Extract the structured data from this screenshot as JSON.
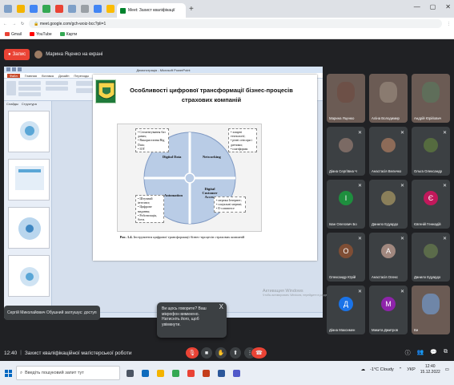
{
  "browser": {
    "active_tab_title": "Meet: Захист кваліфікації",
    "address": "meet.google.com/gch-woiz-bcc?pli=1",
    "bookmarks": [
      "Gmail",
      "YouTube",
      "Карти"
    ]
  },
  "meet_top": {
    "record_label": "Запис",
    "presenter_label": "Марина Яценко на екрані"
  },
  "powerpoint": {
    "window_title": "Демонстрація - Microsoft PowerPoint",
    "menu": [
      "Файл",
      "Главная",
      "Вставка",
      "Дизайн",
      "Переходы",
      "Анимация",
      "Показ слайдов",
      "Рецензирование",
      "Вид"
    ],
    "thumb_tabs": [
      "Слайды",
      "Структура"
    ],
    "status_left": "Слайд 1 из 1",
    "notes_placeholder": "Приложения Microsoft PowerPoint"
  },
  "slide": {
    "title": "Особливості цифрової трансформації бізнес-процесів страхових компаній",
    "segments": [
      "Digital Data",
      "Networking",
      "Automation",
      "Digital Customer Access"
    ],
    "note_tl": "• Сегментування баз даних;\n• Використання Big Data;\n• IOT",
    "note_tr": "• хмарні технології;\n• різні сенсори і датчики;\n• платформи.",
    "note_bl": "• Штучний інтелект;\n• Цифрове видання;\n• Роботизація, боти.",
    "note_br": "• мережа Інтернет;\n• соціальні мережі;\n• Е-commerce",
    "caption_prefix": "Рис. 1.4.",
    "caption_text": " Інструменти цифрової трансформації бізнес-процесів страхових компаній"
  },
  "watermark": [
    "Активация Windows",
    "Чтобы активировать Windows, перейдите в раздел \"Параметры\"."
  ],
  "caption_chip": "Сергій Миколайович Обушний заглушує: доступ",
  "popup": {
    "text": "Ви щось говорите? Ваш мікрофон вимкнено. Натисніть його, щоб увімкнути.",
    "close": "X"
  },
  "participants": [
    {
      "name": "Марина Яценко",
      "letter": "",
      "color": "#6d5047",
      "video": true
    },
    {
      "name": "Аліна Володимир",
      "letter": "",
      "color": "#8a7b70",
      "video": true
    },
    {
      "name": "Андрій Юрійович",
      "letter": "",
      "color": "#5f6e5a",
      "video": true
    },
    {
      "name": "Діана Сергіївна Ч",
      "letter": "",
      "color": "#7b6a64",
      "video": false
    },
    {
      "name": "Анастасія Величко",
      "letter": "",
      "color": "#8d6b58",
      "video": false
    },
    {
      "name": "Ольга Олександр",
      "letter": "",
      "color": "#556b3f",
      "video": false
    },
    {
      "name": "Іван Олегович Бо",
      "letter": "І",
      "color": "#1e8e3e",
      "video": false
    },
    {
      "name": "Данило Едуардо",
      "letter": "",
      "color": "#8a7f5a",
      "video": false
    },
    {
      "name": "Євгеній Геннадій",
      "letter": "Є",
      "color": "#c2185b",
      "video": false
    },
    {
      "name": "Олександр Юрій",
      "letter": "О",
      "color": "#7f4e35",
      "video": false
    },
    {
      "name": "Анастасія Олекс",
      "letter": "А",
      "color": "#a1887f",
      "video": false
    },
    {
      "name": "Данило Едуардо",
      "letter": "",
      "color": "#5b6b4a",
      "video": false
    },
    {
      "name": "Діана Максимен",
      "letter": "Д",
      "color": "#1a73e8",
      "video": false
    },
    {
      "name": "Микита Дмитров",
      "letter": "М",
      "color": "#8e24aa",
      "video": false
    },
    {
      "name": "Ви",
      "letter": "",
      "color": "#6f86a8",
      "video": true
    }
  ],
  "bottom": {
    "time": "12:40",
    "separator": "|",
    "meeting_name": "Захист кваліфікаційної магістерської роботи"
  },
  "windows": {
    "search_placeholder": "Введіть пошуковий запит тут",
    "weather": "-1°C Cloudy",
    "lang": "УКР",
    "clock_time": "12:40",
    "clock_date": "15.12.2022"
  }
}
